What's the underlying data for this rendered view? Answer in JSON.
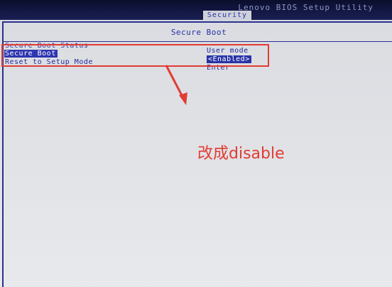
{
  "header": {
    "app_title": "Lenovo BIOS Setup Utility",
    "active_tab": "Security"
  },
  "page": {
    "title": "Secure Boot"
  },
  "settings": [
    {
      "label": "Secure Boot Status",
      "value": "User mode"
    },
    {
      "label": "Secure Boot",
      "value": "<Enabled>"
    },
    {
      "label": "Reset to Setup Mode",
      "value": "Enter"
    }
  ],
  "annotation": {
    "note": "改成disable",
    "color": "#e23b32"
  }
}
